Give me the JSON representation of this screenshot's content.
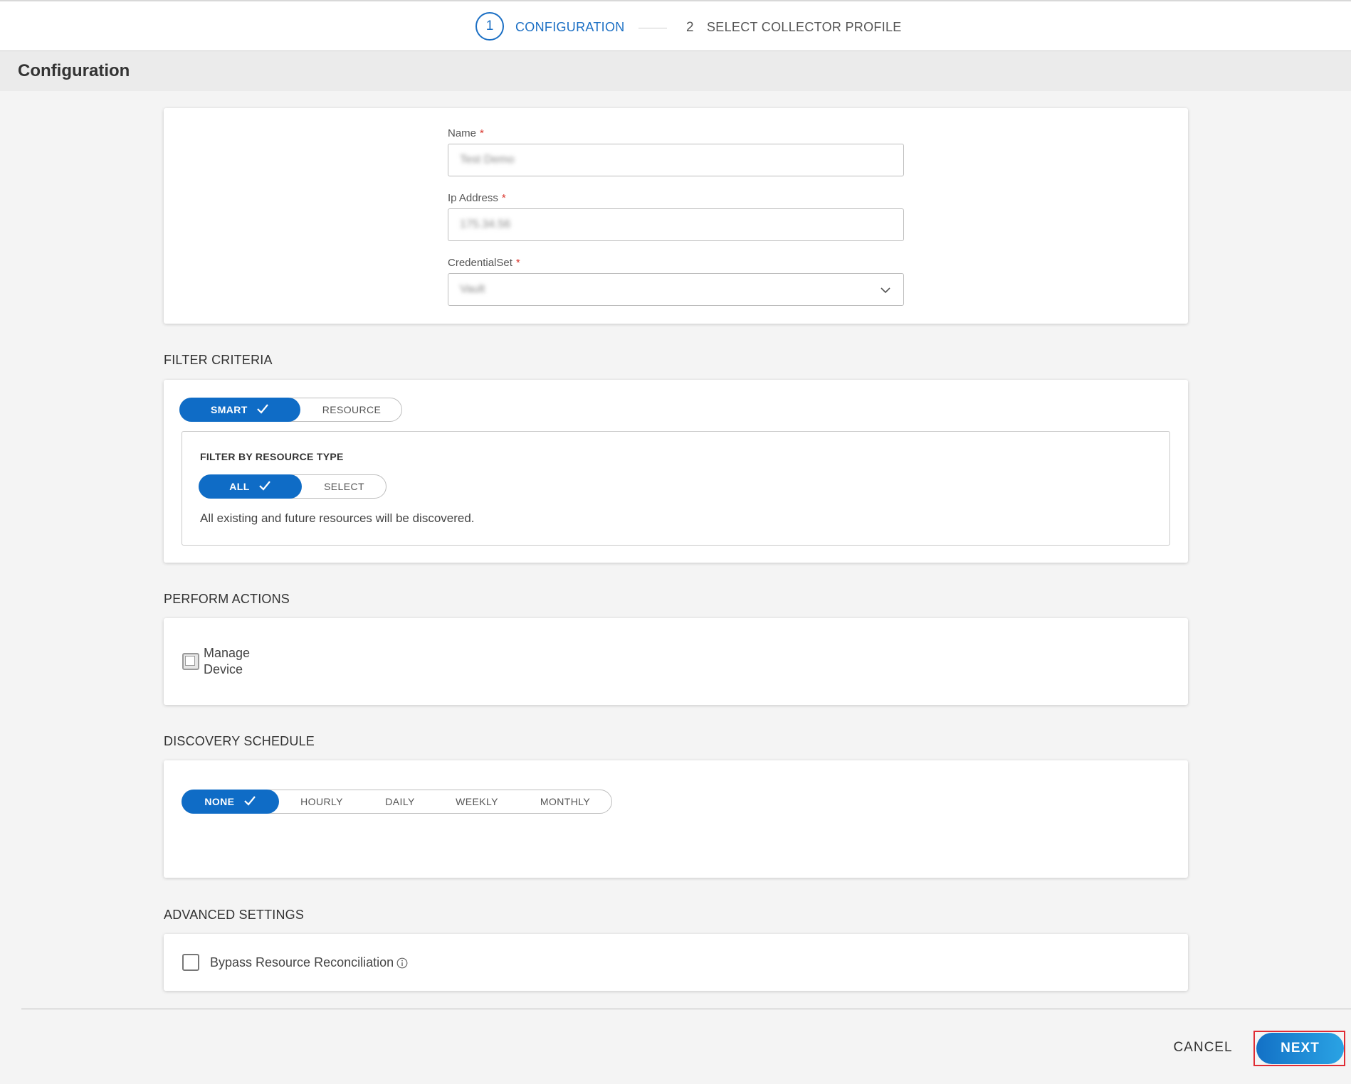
{
  "stepper": {
    "step1_number": "1",
    "step1_label": "CONFIGURATION",
    "step2_number": "2",
    "step2_label": "SELECT COLLECTOR PROFILE"
  },
  "page": {
    "title": "Configuration"
  },
  "form": {
    "name_label": "Name",
    "name_value": "Test Demo",
    "ip_label": "Ip Address",
    "ip_value": "175.34.56",
    "credential_label": "CredentialSet",
    "credential_value": "Vault",
    "required_marker": "*"
  },
  "filter_criteria": {
    "title": "FILTER CRITERIA",
    "tabs": [
      "SMART",
      "RESOURCE"
    ],
    "selected": "SMART",
    "resource_type_title": "FILTER BY RESOURCE TYPE",
    "resource_type_tabs": [
      "ALL",
      "SELECT"
    ],
    "resource_type_selected": "ALL",
    "hint": "All existing and future resources will be discovered."
  },
  "perform_actions": {
    "title": "PERFORM ACTIONS",
    "manage_device_label_line1": "Manage",
    "manage_device_label_line2": "Device"
  },
  "discovery_schedule": {
    "title": "DISCOVERY SCHEDULE",
    "options": [
      "NONE",
      "HOURLY",
      "DAILY",
      "WEEKLY",
      "MONTHLY"
    ],
    "selected": "NONE"
  },
  "advanced_settings": {
    "title": "ADVANCED SETTINGS",
    "bypass_label": "Bypass Resource Reconciliation"
  },
  "footer": {
    "cancel_label": "CANCEL",
    "next_label": "NEXT"
  },
  "colors": {
    "primary": "#0f6cc6",
    "required": "#d9342b",
    "highlight": "#e02c34"
  }
}
